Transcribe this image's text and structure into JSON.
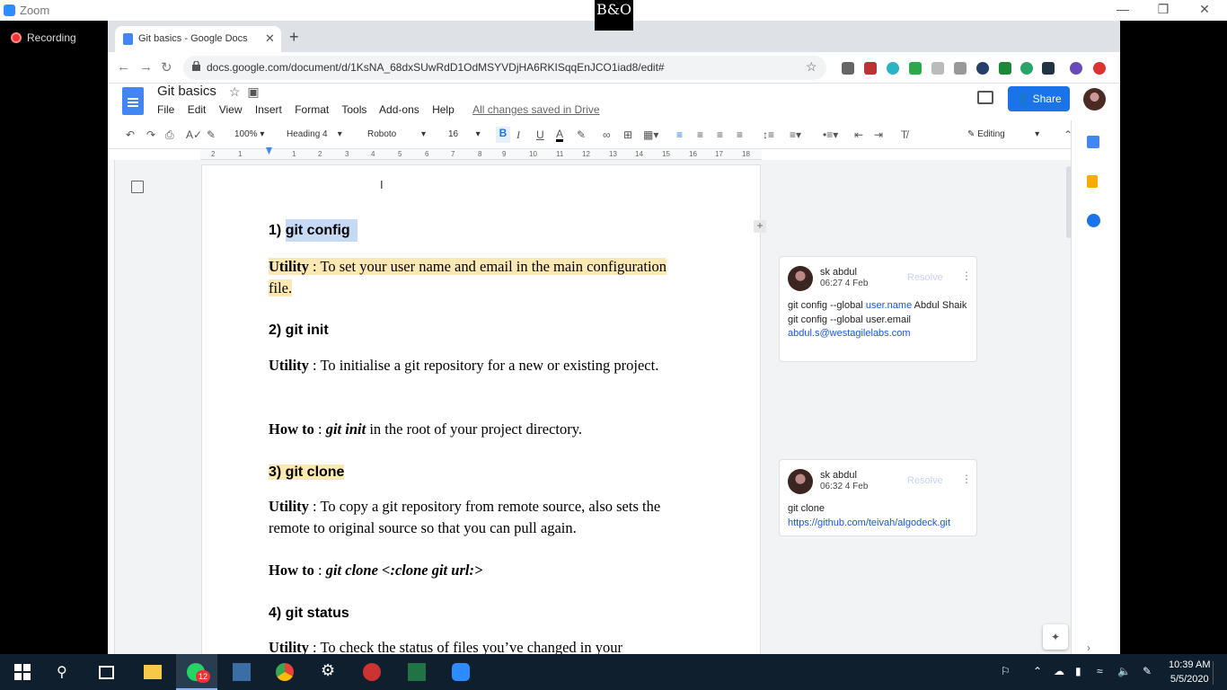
{
  "zoom": {
    "title": "Zoom",
    "recording": "Recording",
    "logo_text": "B&O"
  },
  "browser": {
    "tab_title": "Git basics - Google Docs",
    "url": "docs.google.com/document/d/1KsNA_68dxSUwRdD1OdMSYVDjHA6RKISqqEnJCO1iad8/edit#"
  },
  "docs": {
    "title": "Git basics",
    "menu": [
      "File",
      "Edit",
      "View",
      "Insert",
      "Format",
      "Tools",
      "Add-ons",
      "Help"
    ],
    "saved_status": "All changes saved in Drive",
    "share_label": "Share",
    "toolbar": {
      "zoom": "100%",
      "style": "Heading 4",
      "font": "Roboto",
      "size": "16",
      "mode": "Editing"
    },
    "ruler_numbers": [
      "2",
      "1",
      "1",
      "2",
      "3",
      "4",
      "5",
      "6",
      "7",
      "8",
      "9",
      "10",
      "11",
      "12",
      "13",
      "14",
      "15",
      "16",
      "17",
      "18"
    ]
  },
  "content": {
    "h1_num": "1)",
    "h1_text": "git config",
    "p1_label": "Utility",
    "p1_text": " : To set your user name and email in the main configuration file.",
    "h2": "2) git init",
    "p2_label": "Utility",
    "p2_text": " : To initialise a git repository for a new or existing project.",
    "p3_label": "How to",
    "p3_sep": " : ",
    "p3_code": "git init",
    "p3_text": " in the root of your project directory.",
    "h3": "3) git clone",
    "p4_label": "Utility",
    "p4_text": " : To copy a git repository from remote source, also sets the remote to original source so that you can pull again.",
    "p5_label": "How to",
    "p5_sep": " : ",
    "p5_code": "git clone <:clone git url:>",
    "h4": "4) git status",
    "p6_label": "Utility",
    "p6_text": " : To check the status of files you’ve changed in your"
  },
  "comments": [
    {
      "author": "sk abdul",
      "time": "06:27 4 Feb",
      "resolve": "Resolve",
      "line1_pre": "git config --global ",
      "line1_link": "user.name",
      "line1_post": " Abdul Shaik",
      "line2": "git config --global user.email",
      "line3_link": "abdul.s@westagilelabs.com"
    },
    {
      "author": "sk abdul",
      "time": "06:32 4 Feb",
      "resolve": "Resolve",
      "line1": "git clone",
      "line2_link": "https://github.com/teivah/algodeck.git"
    }
  ],
  "taskbar": {
    "time": "10:39 AM",
    "date": "5/5/2020",
    "badge": "12"
  }
}
